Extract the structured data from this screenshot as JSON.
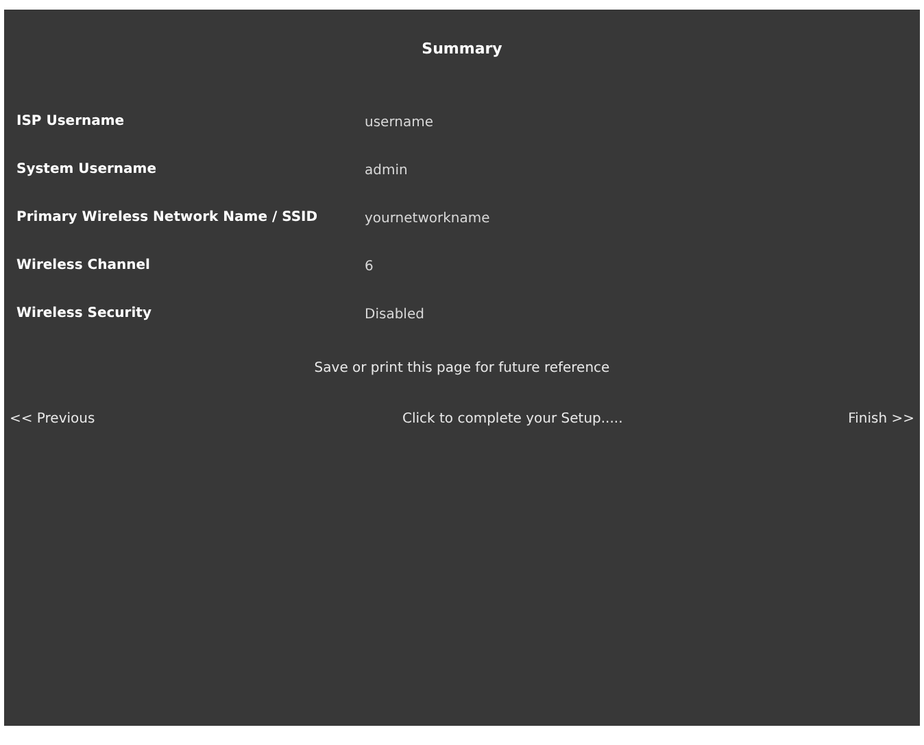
{
  "title": "Summary",
  "rows": [
    {
      "label": "ISP Username",
      "value": "username"
    },
    {
      "label": "System Username",
      "value": "admin"
    },
    {
      "label": "Primary Wireless Network Name / SSID",
      "value": "yournetworkname"
    },
    {
      "label": "Wireless Channel",
      "value": "6"
    },
    {
      "label": "Wireless Security",
      "value": "Disabled"
    }
  ],
  "note": "Save or print this page for future reference",
  "nav": {
    "previous": "<< Previous",
    "instruction": "Click to complete your Setup.....",
    "finish": "Finish >>"
  }
}
